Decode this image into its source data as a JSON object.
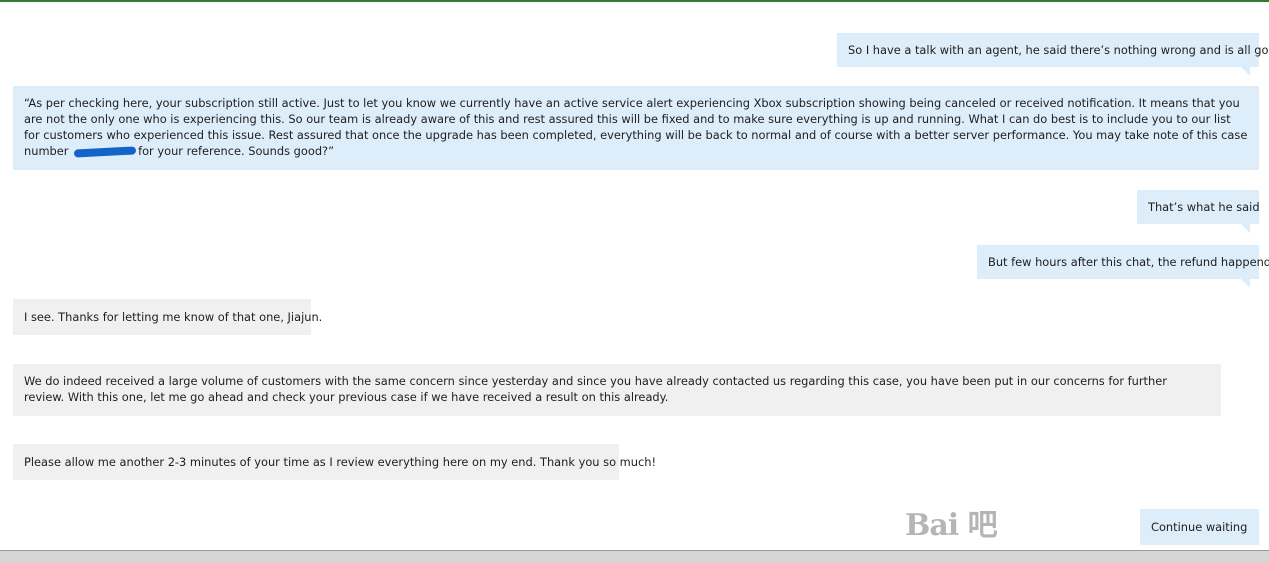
{
  "messages": [
    {
      "role": "user",
      "text": "So I have a talk with an agent, he said there’s nothing wrong and is all good"
    },
    {
      "role": "user",
      "text_before": "“As per checking here, your subscription still active. Just to let you know we currently have an active service alert experiencing Xbox subscription showing being canceled or received notification. It means that you are not the only one who is experiencing this. So our team is already aware of this and rest assured this will be fixed and to make sure everything is up and running. What I can do best is to include you to our list for customers who experienced this issue. Rest assured that once the upgrade has been completed, everything will be back to normal and of course with a better server performance. You may take note of this case number ",
      "text_after": "for your reference. Sounds good?”"
    },
    {
      "role": "user",
      "text": "That’s what he said"
    },
    {
      "role": "user",
      "text": "But few hours after this chat, the refund happend"
    },
    {
      "role": "agent",
      "text": "I see. Thanks for letting me know of that one, Jiajun."
    },
    {
      "role": "agent",
      "text": "We do indeed received a large volume of customers with the same concern since yesterday and since you have already contacted us regarding this case, you have been put in our concerns for further review. With this one, let me go ahead and check your previous case if we have received a result on this already."
    },
    {
      "role": "agent",
      "text": "Please allow me another 2-3 minutes of your time as I review everything here on my end. Thank you so much!"
    },
    {
      "role": "user",
      "text": "Continue waiting"
    }
  ],
  "watermark": {
    "text": "Bai   吧"
  },
  "colors": {
    "sent_bubble": "#deedfa",
    "received_bubble": "#f0f0f0",
    "accent": "#2e7d32",
    "redaction": "#1463c8"
  }
}
